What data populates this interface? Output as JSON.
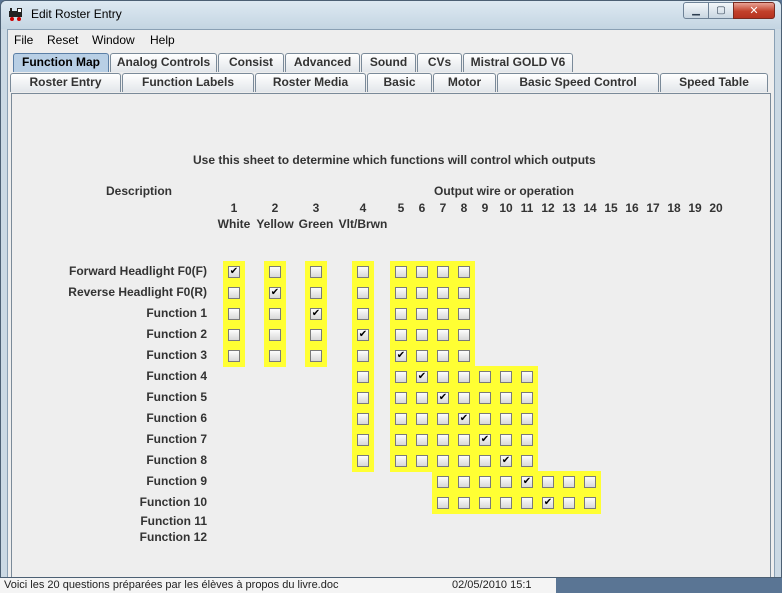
{
  "window": {
    "title": "Edit Roster Entry",
    "buttons": {
      "minimize": "▁",
      "maximize": "▢",
      "close": "✕"
    }
  },
  "menu": [
    "File",
    "Reset",
    "Window",
    "Help"
  ],
  "tabs_row1": [
    {
      "label": "Function Map",
      "selected": true
    },
    {
      "label": "Analog Controls",
      "selected": false
    },
    {
      "label": "Consist",
      "selected": false
    },
    {
      "label": "Advanced",
      "selected": false
    },
    {
      "label": "Sound",
      "selected": false
    },
    {
      "label": "CVs",
      "selected": false
    },
    {
      "label": "Mistral GOLD V6",
      "selected": false
    }
  ],
  "tabs_row2": [
    {
      "label": "Roster Entry"
    },
    {
      "label": "Function Labels"
    },
    {
      "label": "Roster Media"
    },
    {
      "label": "Basic"
    },
    {
      "label": "Motor"
    },
    {
      "label": "Basic Speed Control"
    },
    {
      "label": "Speed Table"
    }
  ],
  "sheet": {
    "instructions": "Use this sheet to determine which functions will control which outputs",
    "description_header": "Description",
    "output_header": "Output wire or operation",
    "columns": [
      {
        "num": "1",
        "name": "White"
      },
      {
        "num": "2",
        "name": "Yellow"
      },
      {
        "num": "3",
        "name": "Green"
      },
      {
        "num": "4",
        "name": "Vlt/Brwn"
      },
      {
        "num": "5",
        "name": ""
      },
      {
        "num": "6",
        "name": ""
      },
      {
        "num": "7",
        "name": ""
      },
      {
        "num": "8",
        "name": ""
      },
      {
        "num": "9",
        "name": ""
      },
      {
        "num": "10",
        "name": ""
      },
      {
        "num": "11",
        "name": ""
      },
      {
        "num": "12",
        "name": ""
      },
      {
        "num": "13",
        "name": ""
      },
      {
        "num": "14",
        "name": ""
      },
      {
        "num": "15",
        "name": ""
      },
      {
        "num": "16",
        "name": ""
      },
      {
        "num": "17",
        "name": ""
      },
      {
        "num": "18",
        "name": ""
      },
      {
        "num": "19",
        "name": ""
      },
      {
        "num": "20",
        "name": ""
      }
    ],
    "rows": [
      {
        "label": "Forward Headlight F0(F)",
        "outputs": [
          1,
          2,
          3,
          4,
          5,
          6,
          7,
          8
        ],
        "checked": [
          1
        ]
      },
      {
        "label": "Reverse Headlight F0(R)",
        "outputs": [
          1,
          2,
          3,
          4,
          5,
          6,
          7,
          8
        ],
        "checked": [
          2
        ]
      },
      {
        "label": "Function 1",
        "outputs": [
          1,
          2,
          3,
          4,
          5,
          6,
          7,
          8
        ],
        "checked": [
          3
        ]
      },
      {
        "label": "Function 2",
        "outputs": [
          1,
          2,
          3,
          4,
          5,
          6,
          7,
          8
        ],
        "checked": [
          4
        ]
      },
      {
        "label": "Function 3",
        "outputs": [
          1,
          2,
          3,
          4,
          5,
          6,
          7,
          8
        ],
        "checked": [
          5
        ]
      },
      {
        "label": "Function 4",
        "outputs": [
          4,
          5,
          6,
          7,
          8,
          9,
          10,
          11
        ],
        "checked": [
          6
        ]
      },
      {
        "label": "Function 5",
        "outputs": [
          4,
          5,
          6,
          7,
          8,
          9,
          10,
          11
        ],
        "checked": [
          7
        ]
      },
      {
        "label": "Function 6",
        "outputs": [
          4,
          5,
          6,
          7,
          8,
          9,
          10,
          11
        ],
        "checked": [
          8
        ]
      },
      {
        "label": "Function 7",
        "outputs": [
          4,
          5,
          6,
          7,
          8,
          9,
          10,
          11
        ],
        "checked": [
          9
        ]
      },
      {
        "label": "Function 8",
        "outputs": [
          4,
          5,
          6,
          7,
          8,
          9,
          10,
          11
        ],
        "checked": [
          10
        ]
      },
      {
        "label": "Function 9",
        "outputs": [
          7,
          8,
          9,
          10,
          11,
          12,
          13,
          14
        ],
        "checked": [
          11
        ]
      },
      {
        "label": "Function 10",
        "outputs": [
          7,
          8,
          9,
          10,
          11,
          12,
          13,
          14
        ],
        "checked": [
          12
        ]
      },
      {
        "label": "Function 11",
        "outputs": [],
        "checked": []
      },
      {
        "label": "Function 12",
        "outputs": [],
        "checked": []
      }
    ],
    "check_mark": "✔",
    "highlight_color": "#ffff33"
  },
  "background_window": {
    "text": "Voici les 20 questions préparées par les élèves à propos du livre.doc",
    "date": "02/05/2010 15:1"
  }
}
